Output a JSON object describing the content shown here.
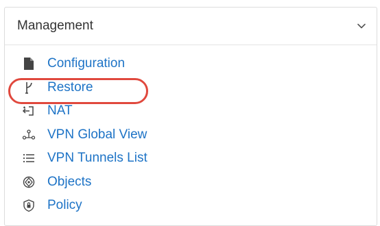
{
  "panel": {
    "title": "Management",
    "toggle_icon": "chevron-down-icon"
  },
  "nav": {
    "items": [
      {
        "label": "Configuration",
        "icon": "document-icon"
      },
      {
        "label": "Restore",
        "icon": "branch-icon"
      },
      {
        "label": "NAT",
        "icon": "nat-icon"
      },
      {
        "label": "VPN Global View",
        "icon": "network-topology-icon"
      },
      {
        "label": "VPN Tunnels List",
        "icon": "list-icon"
      },
      {
        "label": "Objects",
        "icon": "objects-icon"
      },
      {
        "label": "Policy",
        "icon": "policy-shield-icon"
      }
    ]
  },
  "annotation": {
    "highlighted_item": "Restore",
    "highlight_color": "#e0483d"
  },
  "colors": {
    "link": "#1d73c6",
    "text": "#333333",
    "icon": "#555555",
    "border": "#dcdcdc"
  }
}
